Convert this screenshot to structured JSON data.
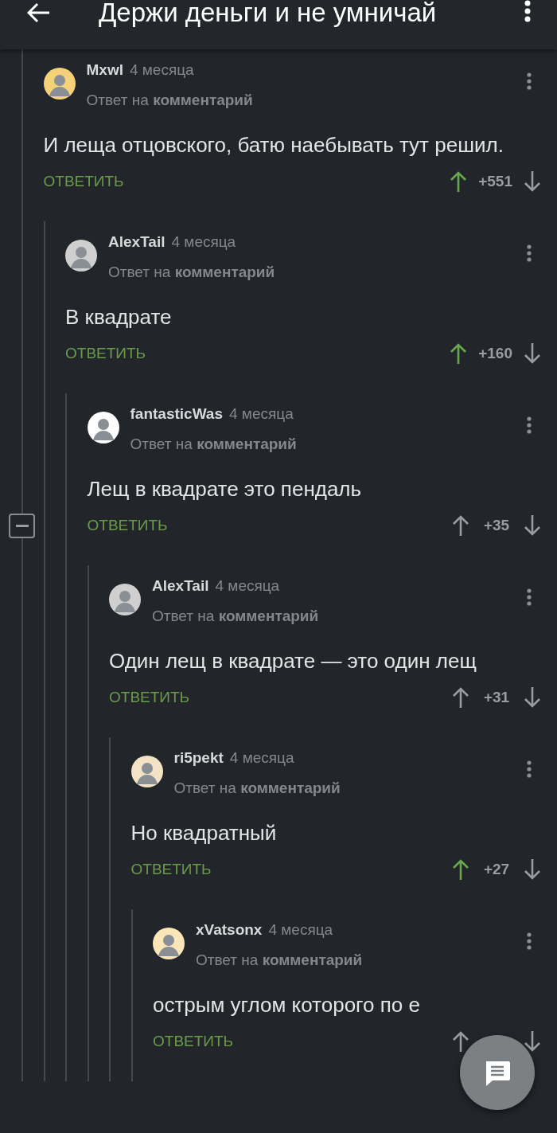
{
  "app_bar": {
    "title": "Держи деньги и не умничай"
  },
  "comments": [
    {
      "author": "Mxwl",
      "time": "4 месяца",
      "reply_to": "Ответ на **комментарий**",
      "text": "И леща отцовского, батю наебывать тут решил.",
      "reply_label": "ОТВЕТИТЬ",
      "score": "+551",
      "up_voted": true,
      "children": [
        {
          "author": "AlexTail",
          "time": "4 месяца",
          "reply_to": "Ответ на **комментарий**",
          "text": "В квадрате",
          "reply_label": "ОТВЕТИТЬ",
          "score": "+160",
          "up_voted": true,
          "children": [
            {
              "author": "fantasticWas",
              "time": "4 месяца",
              "reply_to": "Ответ на **комментарий**",
              "text": "Лещ в квадрате это пендаль",
              "reply_label": "ОТВЕТИТЬ",
              "score": "+35",
              "up_voted": false,
              "children": [
                {
                  "author": "AlexTail",
                  "time": "4 месяца",
                  "reply_to": "Ответ на **комментарий**",
                  "text": "Один лещ в квадрате — это один лещ",
                  "reply_label": "ОТВЕТИТЬ",
                  "score": "+31",
                  "up_voted": false,
                  "children": [
                    {
                      "author": "ri5pekt",
                      "time": "4 месяца",
                      "reply_to": "Ответ на **комментарий**",
                      "text": "Но квадратный",
                      "reply_label": "ОТВЕТИТЬ",
                      "score": "+27",
                      "up_voted": true,
                      "children": [
                        {
                          "author": "xVatsonx",
                          "time": "4 месяца",
                          "reply_to": "Ответ на **комментарий**",
                          "text": "острым углом которого по е",
                          "reply_label": "ОТВЕТИТЬ",
                          "up_voted": false
                        }
                      ]
                    }
                  ]
                }
              ]
            }
          ]
        }
      ]
    }
  ]
}
